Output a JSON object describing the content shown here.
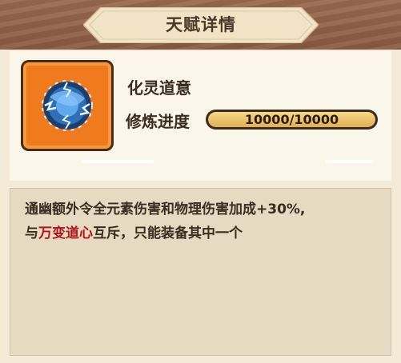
{
  "header": {
    "title": "天赋详情"
  },
  "talent": {
    "name": "化灵道意",
    "icon": "blue-spirit-orb-icon",
    "progress_label": "修炼进度",
    "progress_text": "10000/10000",
    "progress_fraction": 1.0
  },
  "description": {
    "line1": "通幽额外令全元素伤害和物理伤害加成+30%,",
    "line2_prefix": "与",
    "line2_highlight": "万变道心",
    "line2_suffix": "互斥，只能装备其中一个"
  },
  "colors": {
    "accent_orange": "#f07b1f",
    "highlight_red": "#b2151b",
    "progress_gold": "#e4ae52"
  }
}
